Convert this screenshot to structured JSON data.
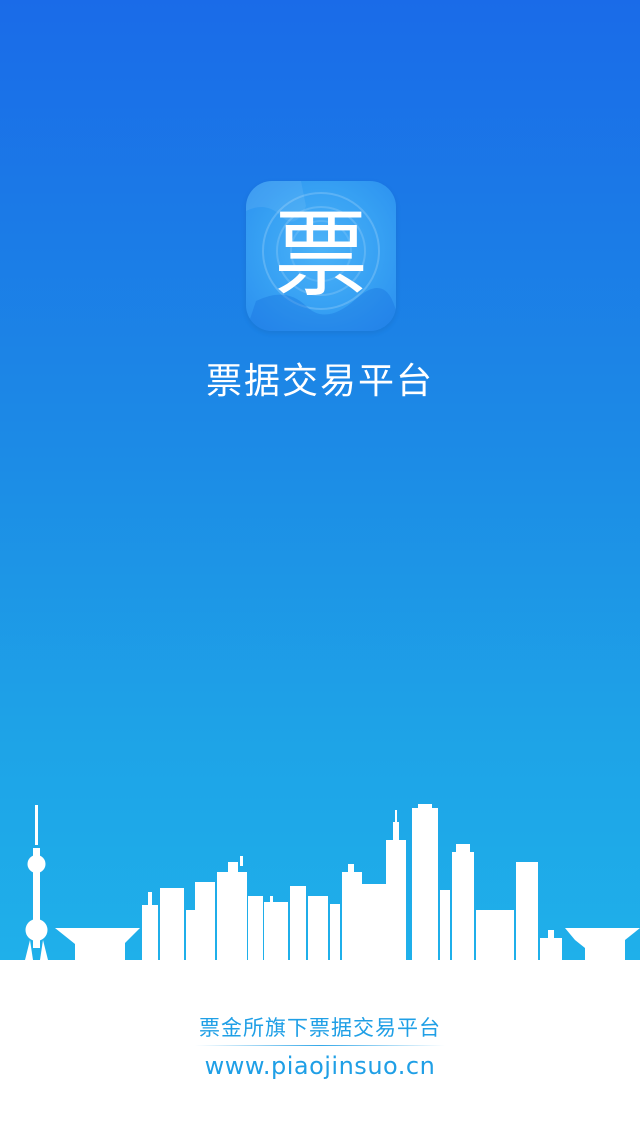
{
  "splash": {
    "app_icon": {
      "glyph": "票",
      "icon": "ticket-character-icon"
    },
    "title": "票据交易平台",
    "skyline_icon": "city-skyline-illustration",
    "footer": {
      "tagline": "票金所旗下票据交易平台",
      "url": "www.piaojinsuo.cn"
    },
    "colors": {
      "gradient_top": "#1a6be8",
      "gradient_bottom": "#1fb1ea",
      "footer_text": "#1f9fe6",
      "icon_bg": "#36a0f3"
    }
  }
}
